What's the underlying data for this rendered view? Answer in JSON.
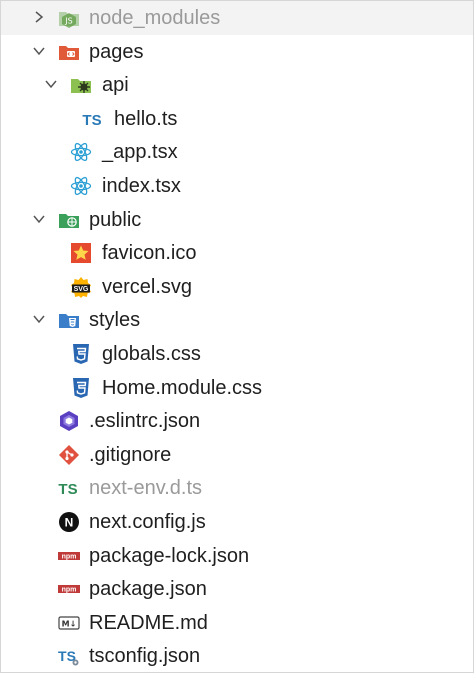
{
  "tree": {
    "node_modules": "node_modules",
    "pages": "pages",
    "api": "api",
    "hello_ts": "hello.ts",
    "app_tsx": "_app.tsx",
    "index_tsx": "index.tsx",
    "public": "public",
    "favicon": "favicon.ico",
    "vercel": "vercel.svg",
    "styles": "styles",
    "globals_css": "globals.css",
    "home_module_css": "Home.module.css",
    "eslintrc": ".eslintrc.json",
    "gitignore": ".gitignore",
    "next_env": "next-env.d.ts",
    "next_config": "next.config.js",
    "package_lock": "package-lock.json",
    "package_json": "package.json",
    "readme": "README.md",
    "tsconfig": "tsconfig.json"
  },
  "icons": {
    "node_modules": "node-modules-folder-icon",
    "pages": "pages-folder-icon",
    "api": "api-folder-icon",
    "typescript": "typescript-icon",
    "react": "react-icon",
    "public": "public-folder-icon",
    "favicon": "favicon-icon",
    "svg": "svg-icon",
    "styles": "styles-folder-icon",
    "css": "css3-icon",
    "eslint": "eslint-icon",
    "git": "git-icon",
    "next": "nextjs-icon",
    "npm": "npm-icon",
    "markdown": "markdown-icon",
    "tsconfig": "tsconfig-icon"
  },
  "icon_labels": {
    "ts": "TS",
    "npm": "npm",
    "svg": "SVG",
    "md": "M↓",
    "next": "N"
  },
  "colors": {
    "typescript": "#2a7ab8",
    "typescript_green": "#2e8b57",
    "react": "#2b9fd4",
    "css": "#2a67b3",
    "eslint": "#5a40c0",
    "git": "#e0523f",
    "npm": "#c13a3a",
    "folder_pages": "#e05a3a",
    "folder_green": "#3aa05a",
    "folder_blue": "#3a7dc8",
    "dim_text": "#9a9a9a"
  }
}
